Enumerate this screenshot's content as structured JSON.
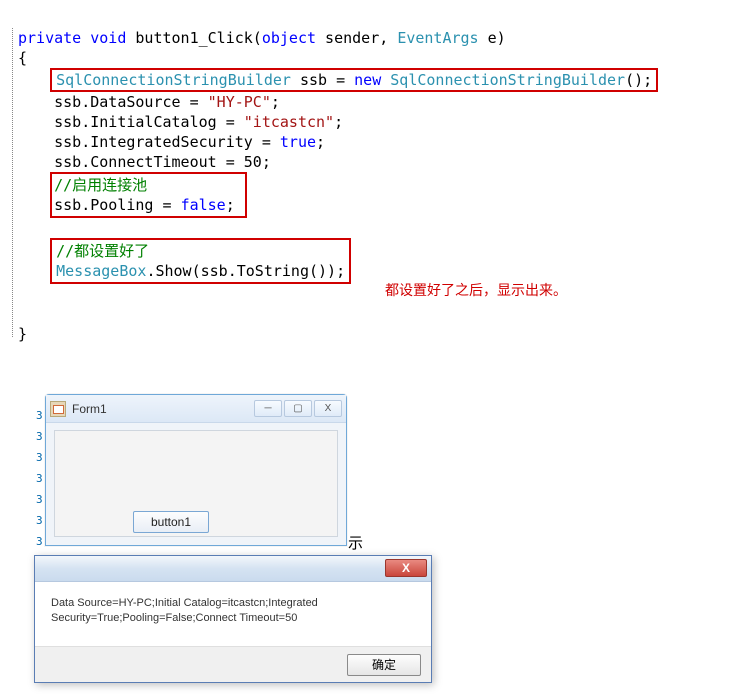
{
  "code": {
    "line1_private": "private",
    "line1_void": "void",
    "line1_name": " button1_Click(",
    "line1_object": "object",
    "line1_sender": " sender, ",
    "line1_EventArgs": "EventArgs",
    "line1_e": " e)",
    "brace_open": "{",
    "box1_type1": "SqlConnectionStringBuilder",
    "box1_mid": " ssb = ",
    "box1_new": "new",
    "box1_space": " ",
    "box1_type2": "SqlConnectionStringBuilder",
    "box1_tail": "();",
    "l3a": "ssb.DataSource = ",
    "l3s": "\"HY-PC\"",
    "l3c": ";",
    "l4a": "ssb.InitialCatalog = ",
    "l4s": "\"itcastcn\"",
    "l4c": ";",
    "l5a": "ssb.IntegratedSecurity = ",
    "l5k": "true",
    "l5c": ";",
    "l6a": "ssb.ConnectTimeout = 50;",
    "box2_c": "//启用连接池",
    "box2_a": "ssb.Pooling = ",
    "box2_k": "false",
    "box2_t": ";",
    "box3_c": "//都设置好了",
    "box3_type": "MessageBox",
    "box3_tail": ".Show(ssb.ToString());",
    "brace_close": "}"
  },
  "annotation": "都设置好了之后，显示出来。",
  "stray": "示",
  "form1": {
    "title": "Form1",
    "minimize": "─",
    "maximize": "▢",
    "close": "X",
    "button_label": "button1"
  },
  "msgbox": {
    "close": "X",
    "text": "Data Source=HY-PC;Initial Catalog=itcastcn;Integrated Security=True;Pooling=False;Connect Timeout=50",
    "ok": "确定"
  }
}
